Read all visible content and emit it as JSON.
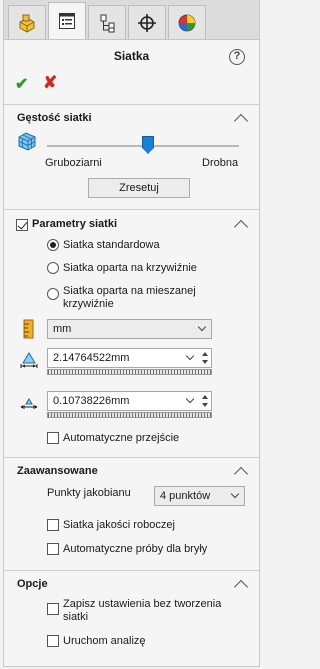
{
  "header": {
    "title": "Siatka",
    "help_symbol": "?"
  },
  "tabs": [
    {
      "name": "part-tab",
      "icon": "part-icon"
    },
    {
      "name": "properties-tab",
      "icon": "property-manager-icon"
    },
    {
      "name": "configuration-tab",
      "icon": "configuration-icon"
    },
    {
      "name": "dimxpert-tab",
      "icon": "crosshair-icon"
    },
    {
      "name": "display-tab",
      "icon": "appearance-icon"
    }
  ],
  "actions": {
    "ok_symbol": "✔",
    "cancel_symbol": "✘"
  },
  "density": {
    "header": "Gęstość siatki",
    "coarse_label": "Gruboziarni",
    "fine_label": "Drobna",
    "slider_level": 0.5,
    "reset_label": "Zresetuj"
  },
  "params": {
    "header": "Parametry siatki",
    "header_checked": true,
    "options": [
      {
        "label": "Siatka standardowa",
        "selected": true
      },
      {
        "label": "Siatka oparta na krzywiźnie",
        "selected": false
      },
      {
        "label": "Siatka oparta na mieszanej krzywiźnie",
        "selected": false
      }
    ],
    "unit_value": "mm",
    "element_size": "2.14764522mm",
    "tolerance": "0.10738226mm",
    "auto_transition_label": "Automatyczne przejście",
    "auto_transition_checked": false
  },
  "advanced": {
    "header": "Zaawansowane",
    "jacobian_label": "Punkty jakobianu",
    "jacobian_value": "4 punktów",
    "draft_quality_label": "Siatka jakości roboczej",
    "draft_quality_checked": false,
    "auto_trials_label": "Automatyczne próby dla bryły",
    "auto_trials_checked": false
  },
  "options": {
    "header": "Opcje",
    "save_no_mesh_label": "Zapisz ustawienia bez tworzenia siatki",
    "save_no_mesh_checked": false,
    "run_analysis_label": "Uruchom analizę",
    "run_analysis_checked": false
  },
  "colors": {
    "ok": "#2e9a2e",
    "cancel": "#cc2a1e",
    "slider_thumb": "#1d7fd6",
    "mesh_icon": "#2b8fd8",
    "unit_icon": "#e0a020"
  }
}
